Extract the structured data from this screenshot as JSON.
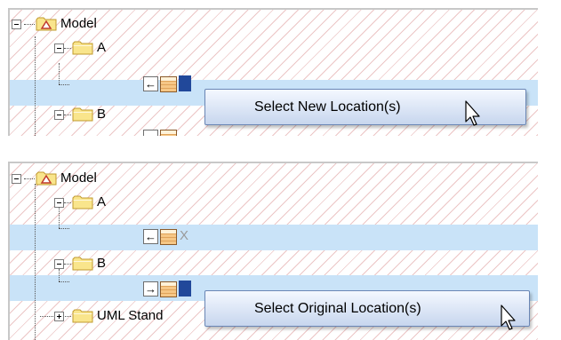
{
  "panels": [
    {
      "rows": [
        {
          "label": "Model",
          "icon": "model-package-icon"
        },
        {
          "label": "A",
          "icon": "folder-icon"
        },
        {
          "label": "",
          "arrow": "←",
          "icon": "element-icon"
        },
        {
          "label": "B",
          "icon": "folder-icon"
        }
      ],
      "context_item": {
        "label": "Select New Location(s)"
      }
    },
    {
      "rows": [
        {
          "label": "Model",
          "icon": "model-package-icon"
        },
        {
          "label": "A",
          "icon": "folder-icon"
        },
        {
          "label": "",
          "arrow": "←",
          "icon": "element-icon",
          "marker": "X"
        },
        {
          "label": "B",
          "icon": "folder-icon"
        },
        {
          "label": "",
          "arrow": "→",
          "icon": "element-icon"
        },
        {
          "label": "UML Stand",
          "icon": "folder-icon"
        }
      ],
      "context_item": {
        "label": "Select Original Location(s)"
      }
    }
  ],
  "colors": {
    "selection": "#c9e3f8",
    "stripe": "#ecc6c6",
    "selected_marker": "#21489a",
    "popup_border": "#6a86b5"
  }
}
